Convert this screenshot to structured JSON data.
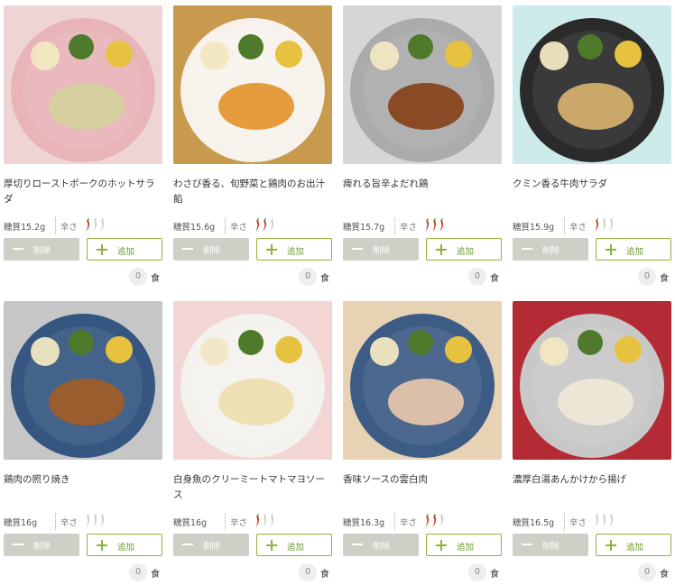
{
  "products": [
    {
      "name": "厚切りローストポークのホットサラダ",
      "sugar": "糖質15.2g",
      "spice_label": "辛さ",
      "spice_level": 1,
      "delete_label": "削除",
      "add_label": "追加",
      "quantity": "0",
      "unit": "食",
      "bg_color": "#efd4d6",
      "plate_color": "#e9b4b8",
      "food_color": "#d6cfa0"
    },
    {
      "name": "わさび香る、旬野菜と鶏肉のお出汁餡",
      "sugar": "糖質15.6g",
      "spice_label": "辛さ",
      "spice_level": 2,
      "delete_label": "削除",
      "add_label": "追加",
      "quantity": "0",
      "unit": "食",
      "bg_color": "#c89a4e",
      "plate_color": "#f7f2ec",
      "food_color": "#e69c3c"
    },
    {
      "name": "痺れる旨辛よだれ鶏",
      "sugar": "糖質15.7g",
      "spice_label": "辛さ",
      "spice_level": 3,
      "delete_label": "削除",
      "add_label": "追加",
      "quantity": "0",
      "unit": "食",
      "bg_color": "#d6d6d6",
      "plate_color": "#ababab",
      "food_color": "#8a4a26"
    },
    {
      "name": "クミン香る牛肉サラダ",
      "sugar": "糖質15.9g",
      "spice_label": "辛さ",
      "spice_level": 1,
      "delete_label": "削除",
      "add_label": "追加",
      "quantity": "0",
      "unit": "食",
      "bg_color": "#cdebea",
      "plate_color": "#2a2a2a",
      "food_color": "#c9a86a"
    },
    {
      "name": "鶏肉の照り焼き",
      "sugar": "糖質16g",
      "spice_label": "辛さ",
      "spice_level": 0,
      "delete_label": "削除",
      "add_label": "追加",
      "quantity": "0",
      "unit": "食",
      "bg_color": "#c6c6c6",
      "plate_color": "#355680",
      "food_color": "#9a5d2e"
    },
    {
      "name": "白身魚のクリーミートマトマヨソース",
      "sugar": "糖質16g",
      "spice_label": "辛さ",
      "spice_level": 1,
      "delete_label": "削除",
      "add_label": "追加",
      "quantity": "0",
      "unit": "食",
      "bg_color": "#f2d6d6",
      "plate_color": "#f4f2ef",
      "food_color": "#efe0b4"
    },
    {
      "name": "香味ソースの雲白肉",
      "sugar": "糖質16.3g",
      "spice_label": "辛さ",
      "spice_level": 2,
      "delete_label": "削除",
      "add_label": "追加",
      "quantity": "0",
      "unit": "食",
      "bg_color": "#e7d3b4",
      "plate_color": "#3d5c85",
      "food_color": "#dcbfa8"
    },
    {
      "name": "濃厚白湯あんかけから揚げ",
      "sugar": "糖質16.5g",
      "spice_label": "辛さ",
      "spice_level": 0,
      "delete_label": "削除",
      "add_label": "追加",
      "quantity": "0",
      "unit": "食",
      "bg_color": "#b42a35",
      "plate_color": "#c8c8c8",
      "food_color": "#ece6d6"
    }
  ],
  "colors": {
    "pepper_active": "#d32a1c",
    "pepper_inactive": "#c5ccc6",
    "pepper_stem": "#5a8a32",
    "accent_green": "#8cb43a",
    "delete_bg": "#cfcfc7"
  },
  "icons": {
    "minus": "minus-icon",
    "plus": "plus-icon",
    "pepper": "chili-pepper-icon"
  }
}
